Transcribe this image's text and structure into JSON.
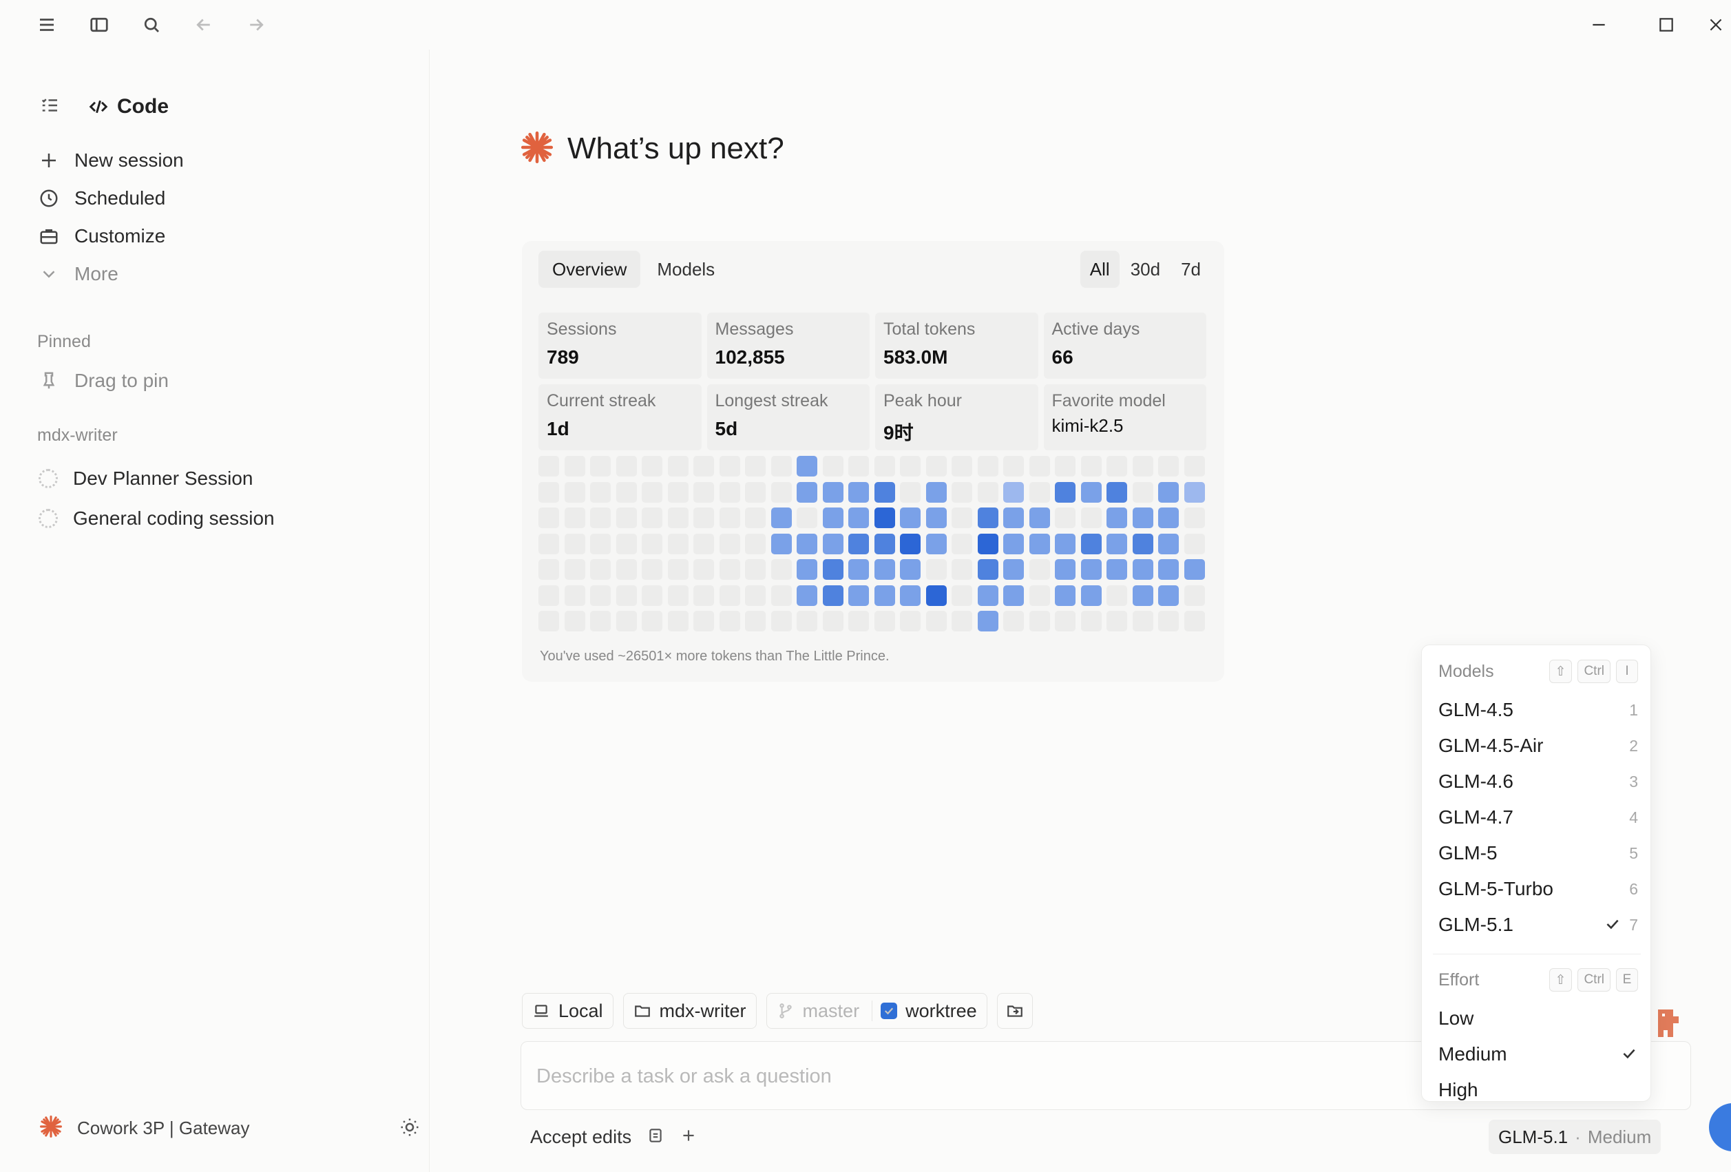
{
  "sidebar": {
    "section_title": "Code",
    "nav": [
      {
        "label": "New session",
        "icon": "plus-icon"
      },
      {
        "label": "Scheduled",
        "icon": "clock-icon"
      },
      {
        "label": "Customize",
        "icon": "briefcase-icon"
      },
      {
        "label": "More",
        "icon": "chevron-down-icon"
      }
    ],
    "pinned_label": "Pinned",
    "pin_hint": "Drag to pin",
    "project_label": "mdx-writer",
    "sessions": [
      "Dev Planner Session",
      "General coding session"
    ],
    "workspace": "Cowork 3P | Gateway"
  },
  "main": {
    "greeting": "What’s up next?"
  },
  "stats": {
    "tabs": [
      "Overview",
      "Models"
    ],
    "active_tab": "Overview",
    "ranges": [
      "All",
      "30d",
      "7d"
    ],
    "active_range": "All",
    "items": [
      {
        "label": "Sessions",
        "value": "789"
      },
      {
        "label": "Messages",
        "value": "102,855"
      },
      {
        "label": "Total tokens",
        "value": "583.0M"
      },
      {
        "label": "Active days",
        "value": "66"
      },
      {
        "label": "Current streak",
        "value": "1d"
      },
      {
        "label": "Longest streak",
        "value": "5d"
      },
      {
        "label": "Peak hour",
        "value": "9时"
      },
      {
        "label": "Favorite model",
        "value": "kimi-k2.5"
      }
    ],
    "footnote": "You've used ~26501× more tokens than The Little Prince.",
    "heatmap_colors": [
      "#ececeb",
      "#9db8ee",
      "#7aa1e8",
      "#4f82de",
      "#2c66d6"
    ],
    "heatmap_levels": [
      [
        0,
        0,
        0,
        0,
        0,
        0,
        0,
        0,
        0,
        0,
        2,
        0,
        0,
        0,
        0,
        0,
        0,
        0,
        0,
        0,
        0,
        0,
        0,
        0,
        0,
        0
      ],
      [
        0,
        0,
        0,
        0,
        0,
        0,
        0,
        0,
        0,
        0,
        2,
        2,
        2,
        3,
        0,
        2,
        0,
        0,
        1,
        0,
        3,
        2,
        3,
        0,
        2,
        1
      ],
      [
        0,
        0,
        0,
        0,
        0,
        0,
        0,
        0,
        0,
        2,
        0,
        2,
        2,
        4,
        2,
        2,
        0,
        3,
        2,
        2,
        0,
        0,
        2,
        2,
        2,
        0
      ],
      [
        0,
        0,
        0,
        0,
        0,
        0,
        0,
        0,
        0,
        2,
        2,
        2,
        3,
        3,
        4,
        2,
        0,
        4,
        2,
        2,
        2,
        3,
        2,
        3,
        2,
        0
      ],
      [
        0,
        0,
        0,
        0,
        0,
        0,
        0,
        0,
        0,
        0,
        2,
        3,
        2,
        2,
        2,
        5,
        0,
        3,
        2,
        0,
        2,
        2,
        2,
        2,
        2,
        2
      ],
      [
        0,
        0,
        0,
        0,
        0,
        0,
        0,
        0,
        0,
        0,
        2,
        3,
        2,
        2,
        2,
        4,
        0,
        2,
        2,
        0,
        2,
        2,
        0,
        2,
        2,
        0
      ],
      [
        0,
        0,
        0,
        0,
        0,
        0,
        0,
        0,
        0,
        0,
        0,
        0,
        0,
        0,
        0,
        0,
        0,
        2,
        0,
        0,
        0,
        0,
        0,
        0,
        0,
        0
      ]
    ]
  },
  "composer": {
    "env": "Local",
    "folder": "mdx-writer",
    "branch": "master",
    "worktree_label": "worktree",
    "placeholder": "Describe a task or ask a question",
    "accept_label": "Accept edits",
    "model_name": "GLM-5.1",
    "model_sep": "·",
    "model_effort": "Medium"
  },
  "dropdown": {
    "models_label": "Models",
    "models_keys": [
      "⇧",
      "Ctrl",
      "I"
    ],
    "models": [
      {
        "name": "GLM-4.5",
        "key": "1",
        "selected": false
      },
      {
        "name": "GLM-4.5-Air",
        "key": "2",
        "selected": false
      },
      {
        "name": "GLM-4.6",
        "key": "3",
        "selected": false
      },
      {
        "name": "GLM-4.7",
        "key": "4",
        "selected": false
      },
      {
        "name": "GLM-5",
        "key": "5",
        "selected": false
      },
      {
        "name": "GLM-5-Turbo",
        "key": "6",
        "selected": false
      },
      {
        "name": "GLM-5.1",
        "key": "7",
        "selected": true
      }
    ],
    "effort_label": "Effort",
    "effort_keys": [
      "⇧",
      "Ctrl",
      "E"
    ],
    "efforts": [
      {
        "name": "Low",
        "selected": false
      },
      {
        "name": "Medium",
        "selected": true
      },
      {
        "name": "High",
        "selected": false
      }
    ]
  },
  "colors": {
    "accent": "#2f6fd6",
    "brand": "#e0623e"
  }
}
